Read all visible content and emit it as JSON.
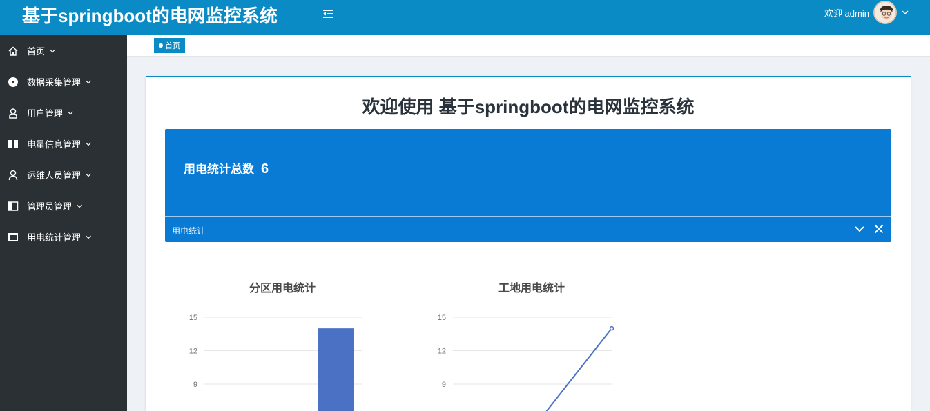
{
  "header": {
    "title": "基于springboot的电网监控系统",
    "welcome": "欢迎 admin"
  },
  "sidebar": {
    "items": [
      {
        "label": "首页",
        "icon": "home-icon"
      },
      {
        "label": "数据采集管理",
        "icon": "disc-icon"
      },
      {
        "label": "用户管理",
        "icon": "user-icon"
      },
      {
        "label": "电量信息管理",
        "icon": "book-icon"
      },
      {
        "label": "运维人员管理",
        "icon": "person-icon"
      },
      {
        "label": "管理员管理",
        "icon": "panel-icon"
      },
      {
        "label": "用电统计管理",
        "icon": "window-icon"
      }
    ]
  },
  "tabs": [
    {
      "label": "首页"
    }
  ],
  "main": {
    "welcome_title": "欢迎使用 基于springboot的电网监控系统",
    "stat_label": "用电统计总数",
    "stat_value": "6",
    "panel_label": "用电统计"
  },
  "colors": {
    "header": "#0a8bc6",
    "sidebar": "#2b3034",
    "stat_box": "#0a7bd4",
    "series": "#4a71c3"
  },
  "chart_data": [
    {
      "type": "bar",
      "title": "分区用电统计",
      "yticks": [
        9,
        12,
        15
      ],
      "ylim_visible": [
        9,
        15
      ],
      "values": [
        14
      ]
    },
    {
      "type": "line",
      "title": "工地用电统计",
      "yticks": [
        9,
        12,
        15
      ],
      "ylim_visible": [
        9,
        15
      ],
      "values": [
        14
      ]
    }
  ]
}
